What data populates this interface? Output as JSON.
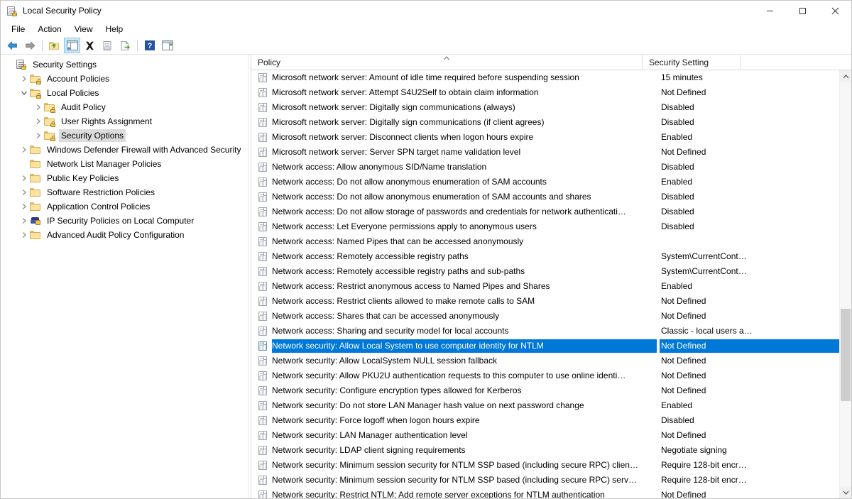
{
  "window": {
    "title": "Local Security Policy",
    "icon": "security-policy-icon",
    "minimize_label": "Minimize",
    "maximize_label": "Maximize",
    "close_label": "Close"
  },
  "menu": {
    "items": [
      {
        "label": "File"
      },
      {
        "label": "Action"
      },
      {
        "label": "View"
      },
      {
        "label": "Help"
      }
    ]
  },
  "toolbar": {
    "buttons": [
      {
        "name": "back-icon",
        "tooltip": "Back"
      },
      {
        "name": "forward-icon",
        "tooltip": "Forward"
      },
      {
        "name": "up-one-level-icon",
        "tooltip": "Up One Level"
      },
      {
        "name": "show-hide-console-tree-icon",
        "tooltip": "Show/Hide Console Tree"
      },
      {
        "name": "delete-icon",
        "tooltip": "Delete"
      },
      {
        "name": "properties-icon",
        "tooltip": "Properties"
      },
      {
        "name": "export-list-icon",
        "tooltip": "Export List"
      },
      {
        "name": "help-icon",
        "tooltip": "Help"
      },
      {
        "name": "show-hide-action-pane-icon",
        "tooltip": "Show/Hide Action Pane"
      }
    ]
  },
  "tree": {
    "items": [
      {
        "label": "Security Settings",
        "indent": 0,
        "twisty": "none",
        "icon": "console-root-icon",
        "selected": false
      },
      {
        "label": "Account Policies",
        "indent": 1,
        "twisty": "collapsed",
        "icon": "folder-lock-icon",
        "selected": false
      },
      {
        "label": "Local Policies",
        "indent": 1,
        "twisty": "expanded",
        "icon": "folder-lock-icon",
        "selected": false
      },
      {
        "label": "Audit Policy",
        "indent": 2,
        "twisty": "collapsed",
        "icon": "folder-lock-icon",
        "selected": false
      },
      {
        "label": "User Rights Assignment",
        "indent": 2,
        "twisty": "collapsed",
        "icon": "folder-lock-icon",
        "selected": false
      },
      {
        "label": "Security Options",
        "indent": 2,
        "twisty": "collapsed",
        "icon": "folder-lock-icon",
        "selected": true
      },
      {
        "label": "Windows Defender Firewall with Advanced Security",
        "indent": 1,
        "twisty": "collapsed",
        "icon": "folder-icon",
        "selected": false
      },
      {
        "label": "Network List Manager Policies",
        "indent": 1,
        "twisty": "none",
        "icon": "folder-icon",
        "selected": false
      },
      {
        "label": "Public Key Policies",
        "indent": 1,
        "twisty": "collapsed",
        "icon": "folder-icon",
        "selected": false
      },
      {
        "label": "Software Restriction Policies",
        "indent": 1,
        "twisty": "collapsed",
        "icon": "folder-icon",
        "selected": false
      },
      {
        "label": "Application Control Policies",
        "indent": 1,
        "twisty": "collapsed",
        "icon": "folder-icon",
        "selected": false
      },
      {
        "label": "IP Security Policies on Local Computer",
        "indent": 1,
        "twisty": "collapsed",
        "icon": "ipsec-icon",
        "selected": false
      },
      {
        "label": "Advanced Audit Policy Configuration",
        "indent": 1,
        "twisty": "collapsed",
        "icon": "folder-icon",
        "selected": false
      }
    ]
  },
  "list": {
    "columns": [
      {
        "label": "Policy",
        "sorted": "asc"
      },
      {
        "label": "Security Setting",
        "sorted": "none"
      }
    ],
    "rows": [
      {
        "policy": "Microsoft network server: Amount of idle time required before suspending session",
        "setting": "15 minutes",
        "selected": false
      },
      {
        "policy": "Microsoft network server: Attempt S4U2Self to obtain claim information",
        "setting": "Not Defined",
        "selected": false
      },
      {
        "policy": "Microsoft network server: Digitally sign communications (always)",
        "setting": "Disabled",
        "selected": false
      },
      {
        "policy": "Microsoft network server: Digitally sign communications (if client agrees)",
        "setting": "Disabled",
        "selected": false
      },
      {
        "policy": "Microsoft network server: Disconnect clients when logon hours expire",
        "setting": "Enabled",
        "selected": false
      },
      {
        "policy": "Microsoft network server: Server SPN target name validation level",
        "setting": "Not Defined",
        "selected": false
      },
      {
        "policy": "Network access: Allow anonymous SID/Name translation",
        "setting": "Disabled",
        "selected": false
      },
      {
        "policy": "Network access: Do not allow anonymous enumeration of SAM accounts",
        "setting": "Enabled",
        "selected": false
      },
      {
        "policy": "Network access: Do not allow anonymous enumeration of SAM accounts and shares",
        "setting": "Disabled",
        "selected": false
      },
      {
        "policy": "Network access: Do not allow storage of passwords and credentials for network authenticati…",
        "setting": "Disabled",
        "selected": false
      },
      {
        "policy": "Network access: Let Everyone permissions apply to anonymous users",
        "setting": "Disabled",
        "selected": false
      },
      {
        "policy": "Network access: Named Pipes that can be accessed anonymously",
        "setting": "",
        "selected": false
      },
      {
        "policy": "Network access: Remotely accessible registry paths",
        "setting": "System\\CurrentCont…",
        "selected": false
      },
      {
        "policy": "Network access: Remotely accessible registry paths and sub-paths",
        "setting": "System\\CurrentCont…",
        "selected": false
      },
      {
        "policy": "Network access: Restrict anonymous access to Named Pipes and Shares",
        "setting": "Enabled",
        "selected": false
      },
      {
        "policy": "Network access: Restrict clients allowed to make remote calls to SAM",
        "setting": "Not Defined",
        "selected": false
      },
      {
        "policy": "Network access: Shares that can be accessed anonymously",
        "setting": "Not Defined",
        "selected": false
      },
      {
        "policy": "Network access: Sharing and security model for local accounts",
        "setting": "Classic - local users a…",
        "selected": false
      },
      {
        "policy": "Network security: Allow Local System to use computer identity for NTLM",
        "setting": "Not Defined",
        "selected": true
      },
      {
        "policy": "Network security: Allow LocalSystem NULL session fallback",
        "setting": "Not Defined",
        "selected": false
      },
      {
        "policy": "Network security: Allow PKU2U authentication requests to this computer to use online identi…",
        "setting": "Not Defined",
        "selected": false
      },
      {
        "policy": "Network security: Configure encryption types allowed for Kerberos",
        "setting": "Not Defined",
        "selected": false
      },
      {
        "policy": "Network security: Do not store LAN Manager hash value on next password change",
        "setting": "Enabled",
        "selected": false
      },
      {
        "policy": "Network security: Force logoff when logon hours expire",
        "setting": "Disabled",
        "selected": false
      },
      {
        "policy": "Network security: LAN Manager authentication level",
        "setting": "Not Defined",
        "selected": false
      },
      {
        "policy": "Network security: LDAP client signing requirements",
        "setting": "Negotiate signing",
        "selected": false
      },
      {
        "policy": "Network security: Minimum session security for NTLM SSP based (including secure RPC) clien…",
        "setting": "Require 128-bit encr…",
        "selected": false
      },
      {
        "policy": "Network security: Minimum session security for NTLM SSP based (including secure RPC) serv…",
        "setting": "Require 128-bit encr…",
        "selected": false
      },
      {
        "policy": "Network security: Restrict NTLM: Add remote server exceptions for NTLM authentication",
        "setting": "Not Defined",
        "selected": false
      }
    ]
  },
  "scrollbar": {
    "up_arrow": "▲",
    "down_arrow": "▼",
    "thumb_top_pct": 56,
    "thumb_height_pct": 23
  },
  "colors": {
    "selection": "#0078d7",
    "selection_text": "#ffffff",
    "tree_selection": "#dcdcdc",
    "window_bg": "#ffffff",
    "toolbar_active": "#cce8f6"
  }
}
